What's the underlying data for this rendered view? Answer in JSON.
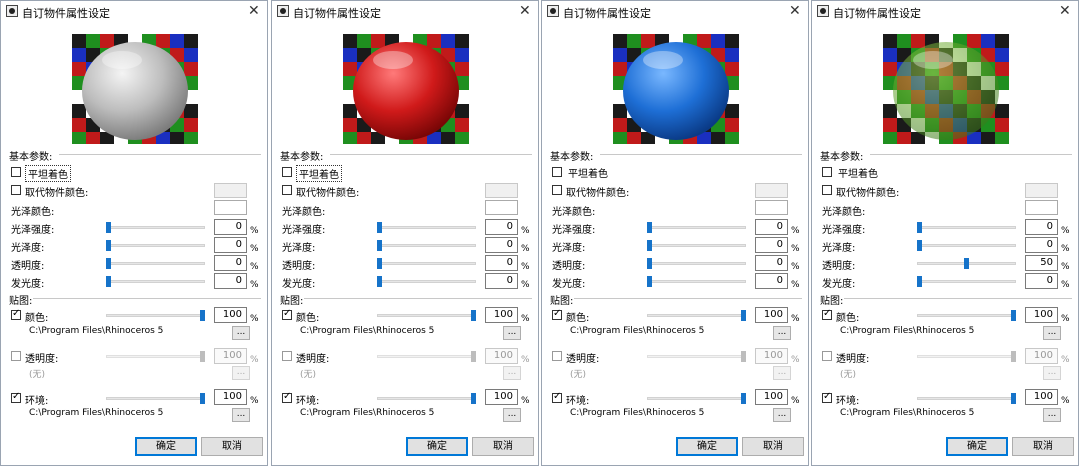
{
  "labels": {
    "title": "自订物件属性设定",
    "close": "✕",
    "basic_params": "基本参数:",
    "flat_shading": "平坦着色",
    "override_color": "取代物件颜色:",
    "gloss_color": "光泽颜色:",
    "gloss_strength": "光泽强度:",
    "glossiness": "光泽度:",
    "transparency": "透明度:",
    "luminance": "发光度:",
    "maps": "贴图:",
    "map_color": "颜色:",
    "map_transparency": "透明度:",
    "map_environment": "环境:",
    "percent": "%",
    "browse": "...",
    "none": "(无)",
    "ok": "确定",
    "cancel": "取消"
  },
  "colors": {
    "accent": "#1673c9",
    "button_focus": "#0078d7"
  },
  "dialogs": [
    {
      "sphere": "white",
      "flat_focused": true,
      "gloss_strength": "0",
      "glossiness": "0",
      "transparency": "0",
      "luminance": "0",
      "map_color": {
        "checked": true,
        "value": "100",
        "path": "C:\\Program Files\\Rhinoceros 5"
      },
      "map_transparency": {
        "checked": false,
        "value": "100"
      },
      "map_environment": {
        "checked": true,
        "value": "100",
        "path": "C:\\Program Files\\Rhinoceros 5"
      }
    },
    {
      "sphere": "red",
      "flat_focused": true,
      "gloss_strength": "0",
      "glossiness": "0",
      "transparency": "0",
      "luminance": "0",
      "map_color": {
        "checked": true,
        "value": "100",
        "path": "C:\\Program Files\\Rhinoceros 5"
      },
      "map_transparency": {
        "checked": false,
        "value": "100"
      },
      "map_environment": {
        "checked": true,
        "value": "100",
        "path": "C:\\Program Files\\Rhinoceros 5"
      }
    },
    {
      "sphere": "blue",
      "flat_focused": false,
      "gloss_strength": "0",
      "glossiness": "0",
      "transparency": "0",
      "luminance": "0",
      "map_color": {
        "checked": true,
        "value": "100",
        "path": "C:\\Program Files\\Rhinoceros 5"
      },
      "map_transparency": {
        "checked": false,
        "value": "100"
      },
      "map_environment": {
        "checked": true,
        "value": "100",
        "path": "C:\\Program Files\\Rhinoceros 5"
      }
    },
    {
      "sphere": "green-transparent",
      "flat_focused": false,
      "gloss_strength": "0",
      "glossiness": "0",
      "transparency": "50",
      "luminance": "0",
      "map_color": {
        "checked": true,
        "value": "100",
        "path": "C:\\Program Files\\Rhinoceros 5"
      },
      "map_transparency": {
        "checked": false,
        "value": "100"
      },
      "map_environment": {
        "checked": true,
        "value": "100",
        "path": "C:\\Program Files\\Rhinoceros 5"
      }
    }
  ]
}
